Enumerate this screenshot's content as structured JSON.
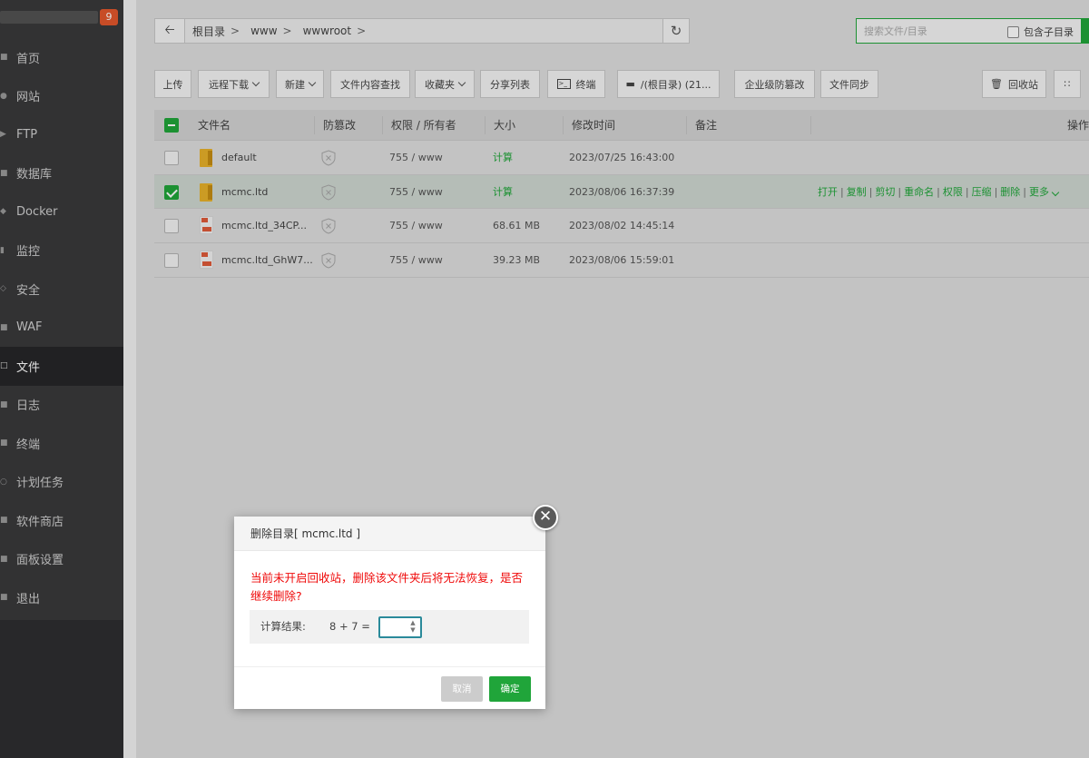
{
  "sidebar": {
    "badge": "9",
    "items": [
      {
        "label": "首页",
        "icon": "home-icon"
      },
      {
        "label": "网站",
        "icon": "globe-icon"
      },
      {
        "label": "FTP",
        "icon": "ftp-icon"
      },
      {
        "label": "数据库",
        "icon": "database-icon"
      },
      {
        "label": "Docker",
        "icon": "docker-icon"
      },
      {
        "label": "监控",
        "icon": "monitor-icon"
      },
      {
        "label": "安全",
        "icon": "shield-icon"
      },
      {
        "label": "WAF",
        "icon": "waf-icon"
      },
      {
        "label": "文件",
        "icon": "folder-icon"
      },
      {
        "label": "日志",
        "icon": "log-icon"
      },
      {
        "label": "终端",
        "icon": "terminal-icon"
      },
      {
        "label": "计划任务",
        "icon": "clock-icon"
      },
      {
        "label": "软件商店",
        "icon": "store-icon"
      },
      {
        "label": "面板设置",
        "icon": "settings-icon"
      },
      {
        "label": "退出",
        "icon": "logout-icon"
      }
    ],
    "active_label": "文件"
  },
  "address": {
    "crumbs": [
      "根目录",
      "www",
      "wwwroot"
    ],
    "separator": ">"
  },
  "search": {
    "placeholder": "搜索文件/目录",
    "include_subdir": "包含子目录"
  },
  "toolbar": {
    "upload": "上传",
    "remote_download": "远程下载",
    "new": "新建",
    "content_search": "文件内容查找",
    "favorites": "收藏夹",
    "share_list": "分享列表",
    "terminal": "终端",
    "disk": "/(根目录) (21...",
    "tamper_proof": "企业级防篡改",
    "file_sync": "文件同步",
    "recycle_bin": "回收站"
  },
  "table": {
    "headers": {
      "name": "文件名",
      "tamper": "防篡改",
      "perm": "权限 / 所有者",
      "size": "大小",
      "mtime": "修改时间",
      "note": "备注",
      "ops": "操作"
    },
    "rows": [
      {
        "name": "default",
        "type": "folder",
        "perm": "755 / www",
        "size": "计算",
        "size_is_link": true,
        "mtime": "2023/07/25 16:43:00",
        "selected": false
      },
      {
        "name": "mcmc.ltd",
        "type": "folder",
        "perm": "755 / www",
        "size": "计算",
        "size_is_link": true,
        "mtime": "2023/08/06 16:37:39",
        "selected": true
      },
      {
        "name": "mcmc.ltd_34CP...",
        "type": "archive",
        "perm": "755 / www",
        "size": "68.61 MB",
        "size_is_link": false,
        "mtime": "2023/08/02 14:45:14",
        "selected": false
      },
      {
        "name": "mcmc.ltd_GhW7...",
        "type": "archive",
        "perm": "755 / www",
        "size": "39.23 MB",
        "size_is_link": false,
        "mtime": "2023/08/06 15:59:01",
        "selected": false
      }
    ],
    "row_ops": [
      "打开",
      "复制",
      "剪切",
      "重命名",
      "权限",
      "压缩",
      "删除",
      "更多"
    ]
  },
  "modal": {
    "title": "删除目录[ mcmc.ltd ]",
    "warning": "当前未开启回收站，删除该文件夹后将无法恢复，是否继续删除?",
    "calc_label": "计算结果:",
    "calc_expr": "8 + 7  =",
    "calc_value": "",
    "cancel": "取消",
    "confirm": "确定"
  },
  "colors": {
    "accent_green": "#20a53a",
    "warning_red": "#ef0808",
    "sidebar_bg": "#39393b",
    "badge_orange": "#e3572c"
  }
}
